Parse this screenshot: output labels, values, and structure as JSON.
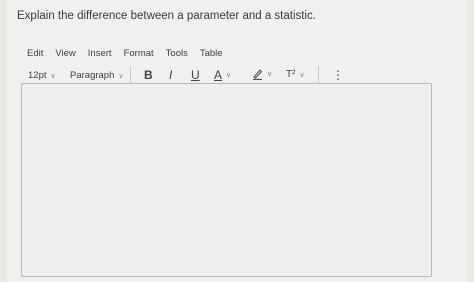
{
  "question": {
    "text": "Explain the difference between a parameter and a statistic."
  },
  "menu": {
    "items": [
      "Edit",
      "View",
      "Insert",
      "Format",
      "Tools",
      "Table"
    ]
  },
  "toolbar": {
    "font_size": "12pt",
    "block_format": "Paragraph",
    "bold": "B",
    "italic": "I",
    "underline": "U",
    "text_color": "A",
    "superscript": "T²",
    "more": "⋮"
  },
  "editor": {
    "content": ""
  }
}
